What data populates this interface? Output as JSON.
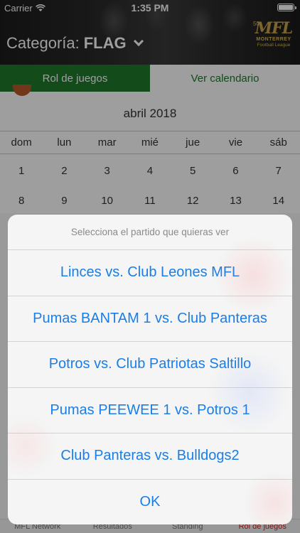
{
  "status_bar": {
    "carrier": "Carrier",
    "time": "1:35 PM"
  },
  "header": {
    "categoria_label": "Categoría:",
    "categoria_value": "FLAG",
    "logo": {
      "years": "50",
      "big": "MFL",
      "line1": "MONTERREY",
      "line2": "Football League"
    }
  },
  "tabs": [
    {
      "label": "Rol de juegos",
      "active": true
    },
    {
      "label": "Ver calendario",
      "active": false
    }
  ],
  "calendar": {
    "month": "abril 2018",
    "weekdays": [
      "dom",
      "lun",
      "mar",
      "mié",
      "jue",
      "vie",
      "sáb"
    ],
    "rows": [
      [
        "1",
        "2",
        "3",
        "4",
        "5",
        "6",
        "7"
      ],
      [
        "8",
        "9",
        "10",
        "11",
        "12",
        "13",
        "14"
      ]
    ]
  },
  "action_sheet": {
    "prompt": "Selecciona el partido que quieras ver",
    "options": [
      "Linces vs. Club Leones MFL",
      "Pumas BANTAM 1 vs. Club Panteras",
      "Potros vs. Club Patriotas Saltillo",
      "Pumas PEEWEE 1 vs. Potros 1",
      "Club Panteras vs. Bulldogs2"
    ],
    "ok": "OK"
  },
  "tabbar": {
    "items": [
      {
        "label": "MFL Network",
        "active": false
      },
      {
        "label": "Resultados",
        "active": false
      },
      {
        "label": "Standing",
        "active": false
      },
      {
        "label": "Rol de juegos",
        "active": true
      }
    ]
  },
  "colors": {
    "green": "#1f7a2b",
    "ios_blue": "#1a7ee6",
    "active_tab_red": "#c62828",
    "logo_gold": "#c8a24a"
  }
}
